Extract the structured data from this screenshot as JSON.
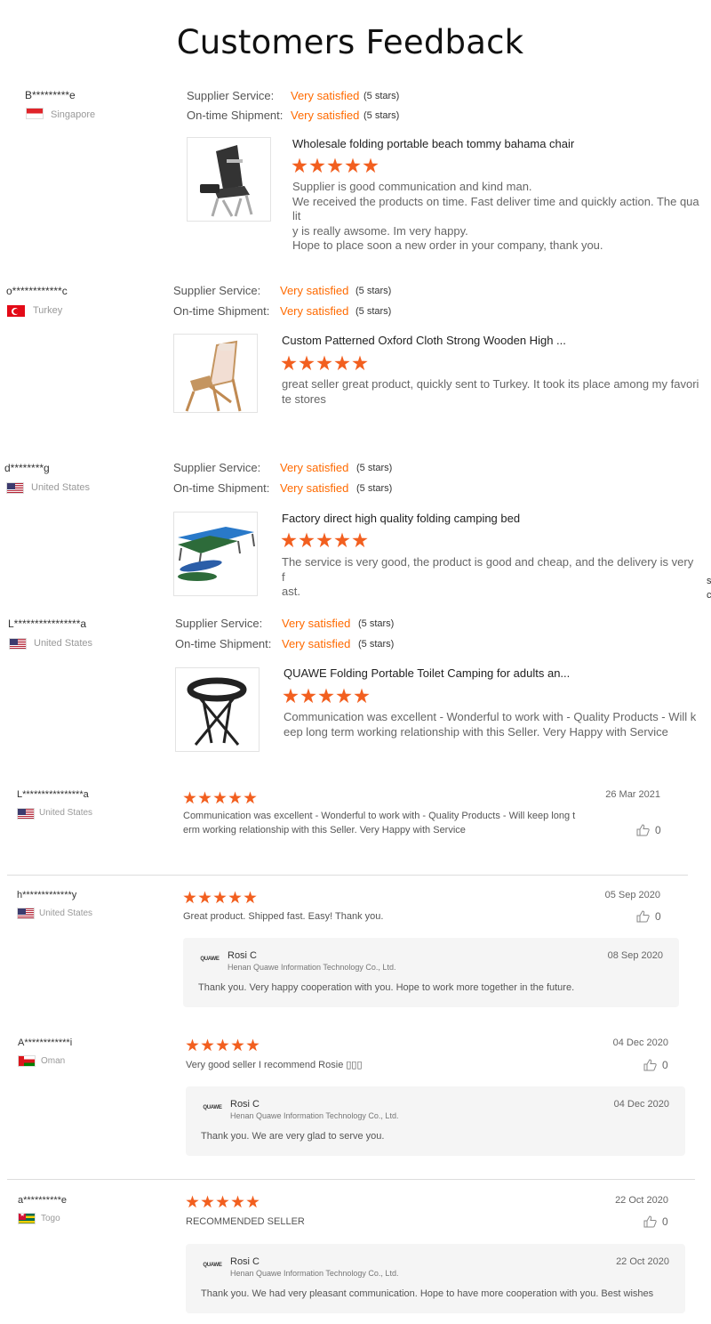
{
  "page": {
    "title": "Customers Feedback"
  },
  "labels": {
    "supplier_service": "Supplier Service:",
    "ontime_shipment": "On-time Shipment:",
    "very_satisfied": "Very satisfied",
    "five_stars": "(5 stars)"
  },
  "colors": {
    "accent": "#ff6a00",
    "star": "#f25f1f"
  },
  "product_reviews": [
    {
      "name": "B*********e",
      "country": "Singapore",
      "flag": "sg",
      "product_title": "Wholesale folding portable beach tommy bahama chair",
      "product_image": "beach-chair-image",
      "rating": 5,
      "comment_lines": [
        "Supplier is good communication and kind man.",
        "We received the products on time. Fast deliver time and quickly action. The qualit",
        "y is really awsome. Im very happy.",
        "Hope to place soon a new order in your company, thank you."
      ]
    },
    {
      "name": "o************c",
      "country": "Turkey",
      "flag": "tr",
      "product_title": "Custom Patterned Oxford Cloth Strong Wooden High ...",
      "product_image": "wooden-chair-image",
      "rating": 5,
      "comment_lines": [
        "great seller great product, quickly sent to Turkey. It took its place among my favori",
        "te stores"
      ]
    },
    {
      "name": "d********g",
      "country": "United States",
      "flag": "us",
      "product_title": "Factory direct high quality folding camping bed",
      "product_image": "camping-bed-image",
      "rating": 5,
      "comment_lines": [
        "The service is very good, the product is good and cheap, and the delivery is very f",
        "ast."
      ]
    },
    {
      "name": "L****************a",
      "country": "United States",
      "flag": "us",
      "product_title": "QUAWE Folding Portable Toilet Camping for adults an...",
      "product_image": "camping-toilet-image",
      "rating": 5,
      "comment_lines": [
        "Communication was excellent - Wonderful to work with - Quality Products -  Will k",
        "eep long term working relationship with this Seller. Very Happy with Service"
      ]
    }
  ],
  "side_fragment": [
    "s",
    "c"
  ],
  "store_reviews": [
    {
      "name": "L****************a",
      "country": "United States",
      "flag": "us",
      "rating": 5,
      "date": "26 Mar 2021",
      "likes": "0",
      "comment_lines": [
        "Communication was excellent - Wonderful to work with - Quality Products -  Will keep long t",
        "erm working relationship with this Seller. Very Happy with Service"
      ],
      "reply": null
    },
    {
      "name": "h*************y",
      "country": "United States",
      "flag": "us",
      "rating": 5,
      "date": "05 Sep 2020",
      "likes": "0",
      "comment_lines": [
        "Great product. Shipped fast. Easy! Thank you."
      ],
      "reply": {
        "logo": "QUAWE",
        "name": "Rosi C",
        "company": "Henan Quawe Information Technology Co., Ltd.",
        "date": "08 Sep 2020",
        "text": "Thank you. Very happy cooperation with you. Hope to work more together in the future."
      }
    },
    {
      "name": "A************i",
      "country": "Oman",
      "flag": "om",
      "rating": 5,
      "date": "04 Dec 2020",
      "likes": "0",
      "comment_lines": [
        "Very good seller I recommend Rosie ▯▯▯"
      ],
      "reply": {
        "logo": "QUAWE",
        "name": "Rosi C",
        "company": "Henan Quawe Information Technology Co., Ltd.",
        "date": "04 Dec 2020",
        "text": "Thank you. We are very glad to serve you."
      }
    },
    {
      "name": "a**********e",
      "country": "Togo",
      "flag": "tg",
      "rating": 5,
      "date": "22 Oct 2020",
      "likes": "0",
      "comment_lines": [
        "RECOMMENDED SELLER"
      ],
      "reply": {
        "logo": "QUAWE",
        "name": "Rosi C",
        "company": "Henan Quawe Information Technology Co., Ltd.",
        "date": "22 Oct 2020",
        "text": "Thank you. We had very pleasant communication. Hope to have more cooperation with you. Best wishes"
      }
    }
  ]
}
